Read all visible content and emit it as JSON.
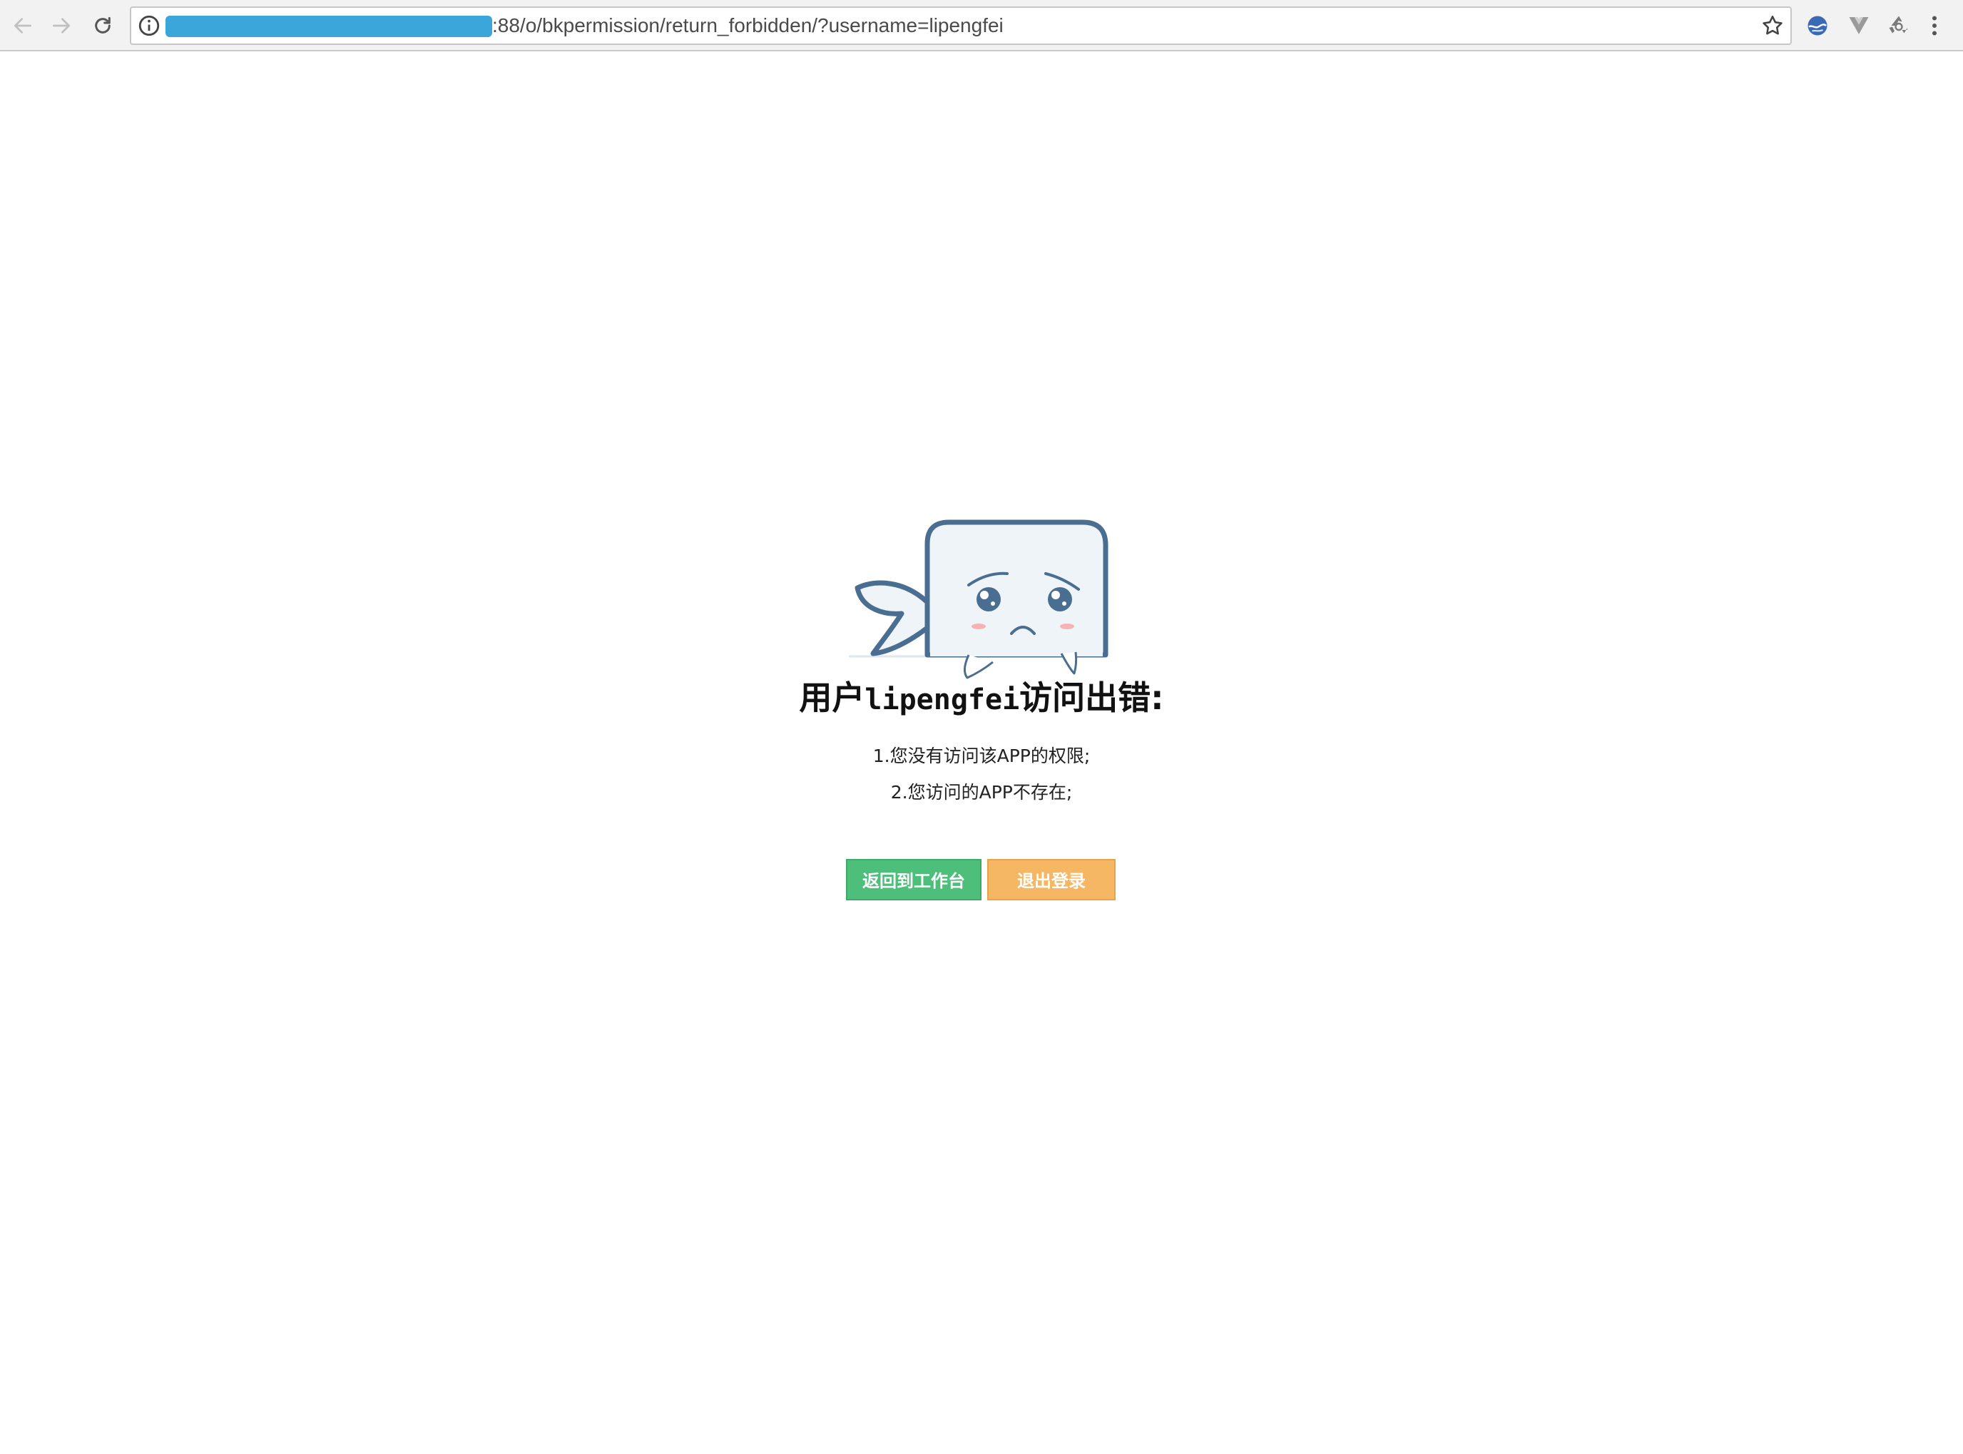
{
  "browser": {
    "url_visible": ":88/o/bkpermission/return_forbidden/?username=lipengfei",
    "host_masked": true,
    "nav": [
      "back-icon",
      "forward-icon",
      "reload-icon"
    ],
    "toolbar_icons": [
      "star-icon",
      "globe-extension-icon",
      "vue-devtools-icon",
      "recycle-extension-icon",
      "menu-dots-icon"
    ]
  },
  "page": {
    "illustration": "sad-whale",
    "title_prefix": "用户",
    "username": "lipengfei",
    "title_suffix": "访问出错:",
    "reasons": [
      "1.您没有访问该APP的权限;",
      "2.您访问的APP不存在;"
    ],
    "buttons": {
      "back_to_workbench": "返回到工作台",
      "logout": "退出登录"
    }
  },
  "colors": {
    "green_button": "#4ebf7b",
    "orange_button": "#f6b765",
    "url_mask": "#3aa6d9",
    "whale_outline": "#4a6e91"
  }
}
